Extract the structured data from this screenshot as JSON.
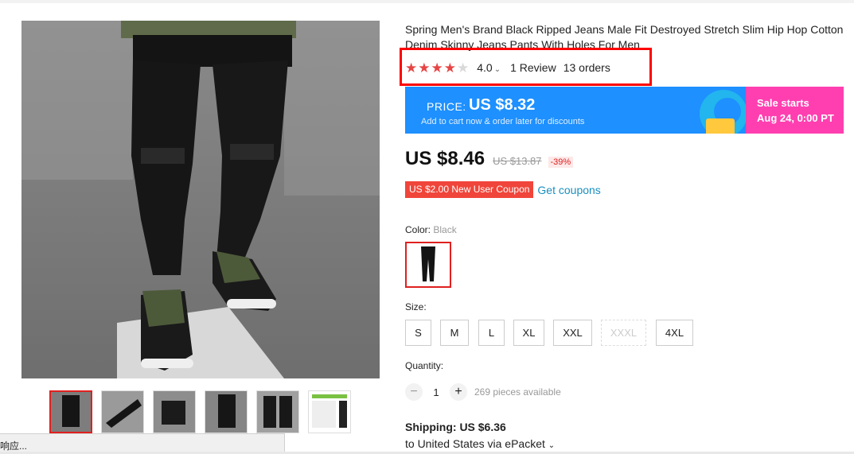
{
  "product": {
    "title": "Spring Men's Brand Black Ripped Jeans Male Fit Destroyed Stretch Slim Hip Hop Cotton Denim Skinny Jeans Pants With Holes For Men",
    "rating_value": "4.0",
    "rating_stars": 4,
    "reviews": "1 Review",
    "orders": "13 orders"
  },
  "promo": {
    "price_label": "PRICE:",
    "price": "US $8.32",
    "sub": "Add to cart now & order later for discounts",
    "sale_starts": "Sale starts",
    "sale_date": "Aug 24, 0:00 PT",
    "colors": {
      "blue": "#1e90ff",
      "pink": "#ff3fb0"
    }
  },
  "pricing": {
    "current": "US $8.46",
    "original": "US $13.87",
    "discount": "-39%"
  },
  "coupon": {
    "tag": "US $2.00 New User Coupon",
    "link": "Get coupons"
  },
  "color": {
    "label": "Color:",
    "selected": "Black"
  },
  "size": {
    "label": "Size:",
    "options": [
      {
        "label": "S",
        "available": true
      },
      {
        "label": "M",
        "available": true
      },
      {
        "label": "L",
        "available": true
      },
      {
        "label": "XL",
        "available": true
      },
      {
        "label": "XXL",
        "available": true
      },
      {
        "label": "XXXL",
        "available": false
      },
      {
        "label": "4XL",
        "available": true
      }
    ]
  },
  "quantity": {
    "label": "Quantity:",
    "value": "1",
    "minus": "−",
    "plus": "+",
    "available": "269 pieces available"
  },
  "shipping": {
    "label": "Shipping:",
    "price": "US $6.36",
    "to": "to United States via ePacket"
  },
  "status_bar": {
    "text": "响应..."
  },
  "accent": {
    "red": "#e02020",
    "link": "#1a8fbf"
  }
}
